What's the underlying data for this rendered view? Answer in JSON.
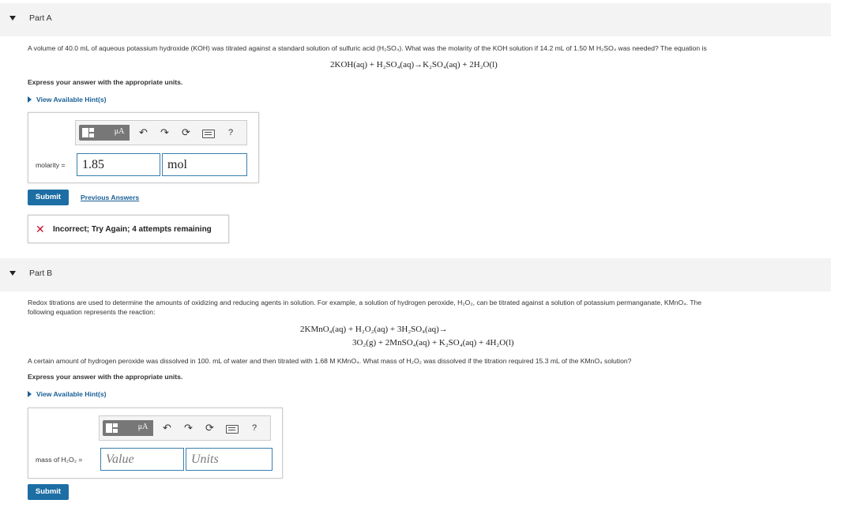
{
  "partA": {
    "title": "Part A",
    "question_line1": "A volume of 40.0 mL of aqueous potassium hydroxide (KOH) was titrated against a standard solution of sulfuric acid (H₂SO₄). What was the molarity of the KOH solution if 14.2 mL of 1.50 M H₂SO₄ was needed? The equation is",
    "equation": "2KOH(aq) + H₂SO₄(aq)→K₂SO₄(aq) + 2H₂O(l)",
    "instruction": "Express your answer with the appropriate units.",
    "hint_link": "View Available Hint(s)",
    "toolbar": {
      "template_icon": "templates-icon",
      "units_label": "μA",
      "undo": "undo-icon",
      "redo": "redo-icon",
      "reset": "reset-icon",
      "keyboard": "keyboard-icon",
      "help_label": "?"
    },
    "answer_label": "molarity =",
    "value": "1.85",
    "units": "mol",
    "submit_label": "Submit",
    "previous_answers": "Previous Answers",
    "feedback": "Incorrect; Try Again; 4 attempts remaining"
  },
  "partB": {
    "title": "Part B",
    "intro_line1": "Redox titrations are used to determine the amounts of oxidizing and reducing agents in solution. For example, a solution of hydrogen peroxide, H₂O₂, can be titrated against a solution of potassium permanganate, KMnO₄. The",
    "intro_line2": "following equation represents the reaction:",
    "equation_line1": "2KMnO₄(aq) + H₂O₂(aq) + 3H₂SO₄(aq)→",
    "equation_line2": "3O₂(g) + 2MnSO₄(aq) + K₂SO₄(aq) + 4H₂O(l)",
    "question": "A certain amount of hydrogen peroxide was dissolved in 100. mL of water and then titrated with 1.68 M KMnO₄. What mass of H₂O₂ was dissolved if the titration required 15.3 mL of the KMnO₄ solution?",
    "instruction": "Express your answer with the appropriate units.",
    "hint_link": "View Available Hint(s)",
    "toolbar": {
      "template_icon": "templates-icon",
      "units_label": "μA",
      "undo": "undo-icon",
      "redo": "redo-icon",
      "reset": "reset-icon",
      "keyboard": "keyboard-icon",
      "help_label": "?"
    },
    "answer_label": "mass of H₂O₂ =",
    "value_placeholder": "Value",
    "units_placeholder": "Units",
    "submit_label": "Submit"
  },
  "colors": {
    "accent": "#1c6ea4",
    "link": "#1a5f95",
    "error": "#c8102e",
    "header_bg": "#f3f3f3"
  }
}
